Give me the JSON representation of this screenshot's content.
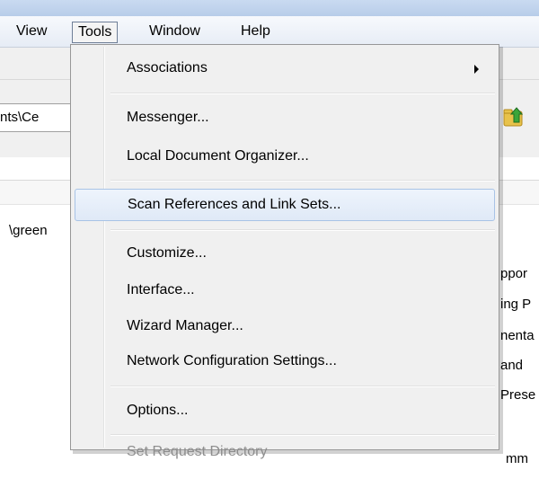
{
  "menubar": {
    "items": [
      {
        "label": "View"
      },
      {
        "label": "Tools"
      },
      {
        "label": "Window"
      },
      {
        "label": "Help"
      }
    ]
  },
  "toolbar": {
    "address_fragment": "nts\\Ce",
    "up_button_icon": "folder-up-icon"
  },
  "content": {
    "left_path_fragment": "\\green",
    "right_fragments": [
      "ppor",
      "ing P",
      "nenta",
      "and",
      "Prese",
      "mm"
    ]
  },
  "tools_menu": {
    "items": [
      {
        "label": "Associations",
        "submenu": true
      },
      {
        "label": "Messenger..."
      },
      {
        "label": "Local Document Organizer..."
      },
      {
        "label": "Scan References and Link Sets...",
        "highlighted": true
      },
      {
        "label": "Customize..."
      },
      {
        "label": "Interface..."
      },
      {
        "label": "Wizard Manager..."
      },
      {
        "label": "Network Configuration Settings..."
      },
      {
        "label": "Options..."
      },
      {
        "label": "Set Request Directory",
        "disabled": true
      }
    ]
  },
  "colors": {
    "menu_background": "#f0f0f0",
    "highlight_border": "#a8c3e6",
    "disabled_text": "#8d8d8d"
  }
}
